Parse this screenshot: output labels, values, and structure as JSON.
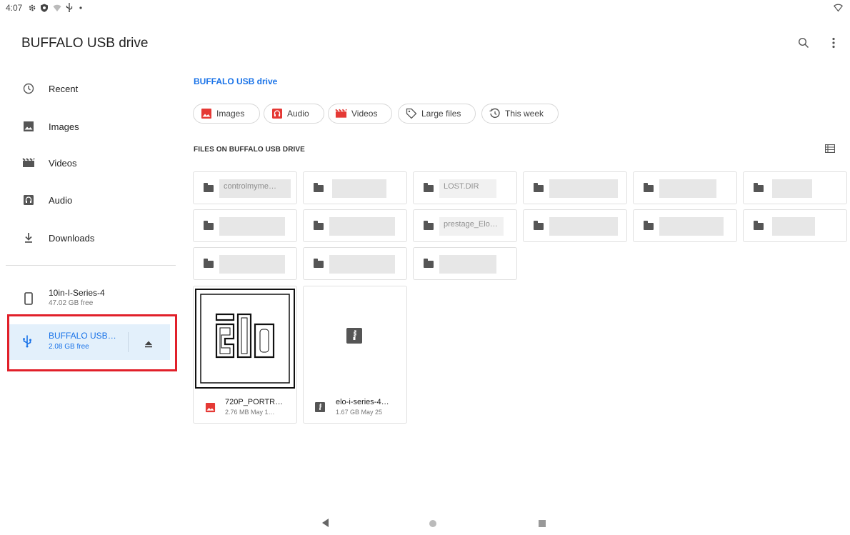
{
  "status_bar": {
    "time": "4:07",
    "icons": [
      "gear-icon",
      "shield-icon",
      "wifi-off-icon",
      "usb-icon",
      "dot-icon"
    ],
    "right_icon": "wifi-icon"
  },
  "app_bar": {
    "title": "BUFFALO USB drive",
    "actions": [
      "search-icon",
      "more-vert-icon"
    ]
  },
  "drawer": {
    "items": [
      {
        "label": "Recent",
        "icon": "clock-icon"
      },
      {
        "label": "Images",
        "icon": "image-icon"
      },
      {
        "label": "Videos",
        "icon": "film-icon"
      },
      {
        "label": "Audio",
        "icon": "audio-icon"
      },
      {
        "label": "Downloads",
        "icon": "download-icon"
      }
    ],
    "roots": [
      {
        "title": "10in-I-Series-4",
        "subtitle": "47.02 GB free",
        "icon": "phone-icon"
      },
      {
        "title": "BUFFALO USB…",
        "subtitle": "2.08 GB free",
        "icon": "usb-icon",
        "action_icon": "eject-icon",
        "selected": true
      }
    ]
  },
  "main": {
    "breadcrumb": "BUFFALO USB drive",
    "chips": [
      {
        "label": "Images",
        "icon": "image-icon"
      },
      {
        "label": "Audio",
        "icon": "audio-icon"
      },
      {
        "label": "Videos",
        "icon": "film-icon"
      },
      {
        "label": "Large files",
        "icon": "tag-icon"
      },
      {
        "label": "This week",
        "icon": "history-icon"
      }
    ],
    "section_title": "FILES ON BUFFALO USB DRIVE",
    "view_toggle_icon": "list-view-icon",
    "folders": [
      {
        "name": "controlmyme…",
        "redacted": true
      },
      {
        "name": "",
        "redacted": true
      },
      {
        "name": "LOST.DIR",
        "redacted": true
      },
      {
        "name": "",
        "redacted": true
      },
      {
        "name": "",
        "redacted": true
      },
      {
        "name": "",
        "redacted": true
      },
      {
        "name": "",
        "redacted": true
      },
      {
        "name": "",
        "redacted": true
      },
      {
        "name": "prestage_Elo…",
        "redacted": true
      },
      {
        "name": "",
        "redacted": true
      },
      {
        "name": "",
        "redacted": true
      },
      {
        "name": "",
        "redacted": true
      },
      {
        "name": "",
        "redacted": true
      },
      {
        "name": "",
        "redacted": true
      },
      {
        "name": "",
        "redacted": true
      }
    ],
    "files": [
      {
        "name": "720P_PORTR…",
        "meta": "2.76 MB May 1…",
        "type_icon": "image-icon",
        "thumbnail": "elo-logo"
      },
      {
        "name": "elo-i-series-4…",
        "meta": "1.67 GB May 25",
        "type_icon": "zip-icon",
        "thumbnail": "zip-icon"
      }
    ]
  },
  "nav_bar": {
    "buttons": [
      "back-icon",
      "home-icon",
      "recents-icon"
    ]
  },
  "colors": {
    "accent": "#1a73e8",
    "highlight_border": "#e1202a",
    "selected_bg": "#e3f0fb",
    "image_icon": "#e53935"
  }
}
